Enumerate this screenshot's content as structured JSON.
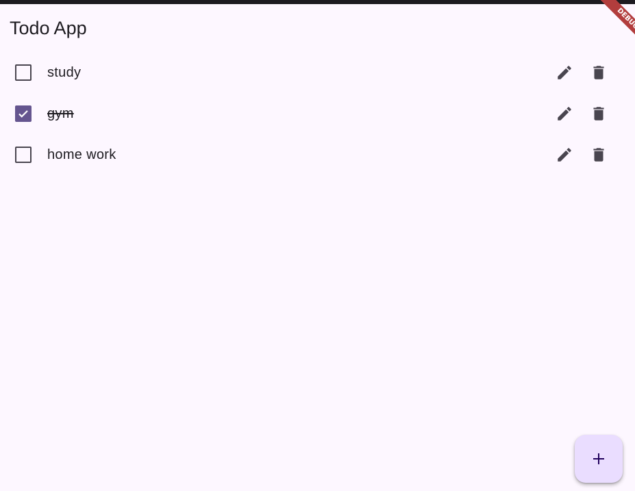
{
  "app": {
    "title": "Todo App",
    "debug_banner": "DEBUG"
  },
  "todos": [
    {
      "label": "study",
      "checked": false
    },
    {
      "label": "gym",
      "checked": true
    },
    {
      "label": "home work",
      "checked": false
    }
  ],
  "icons": {
    "checkbox": "checkbox-icon",
    "check": "check-icon",
    "edit": "pencil-icon",
    "delete": "trash-icon",
    "add": "plus-icon"
  },
  "colors": {
    "background": "#fdf7ff",
    "accent": "#65558f",
    "fab": "#eaddff",
    "icon": "#49454f",
    "debug": "#b23d3d"
  }
}
